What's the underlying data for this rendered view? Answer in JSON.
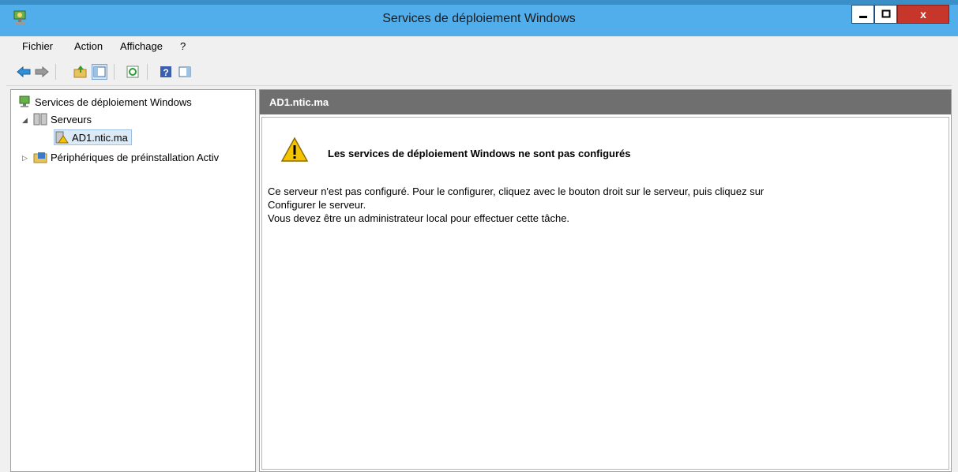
{
  "window": {
    "title": "Services de déploiement Windows",
    "close_label": "x"
  },
  "menu": [
    "Fichier",
    "Action",
    "Affichage",
    "?"
  ],
  "toolbar": {
    "buttons": [
      "back-arrow-icon",
      "forward-arrow-icon",
      "up-folder-icon",
      "show-hide-tree-icon",
      "refresh-icon",
      "help-icon",
      "show-hide-action-pane-icon"
    ]
  },
  "tree": {
    "root": "Services de déploiement Windows",
    "servers": "Serveurs",
    "server_node": "AD1.ntic.ma",
    "devices": "Périphériques de préinstallation Activ"
  },
  "detail": {
    "header": "AD1.ntic.ma",
    "warning_title": "Les services de déploiement Windows ne sont pas configurés",
    "message_line1": "Ce serveur n'est pas configuré. Pour le configurer, cliquez avec le bouton droit sur le serveur, puis cliquez sur",
    "message_line2": "Configurer le serveur.",
    "message_line3": "Vous devez être un administrateur local pour effectuer cette tâche."
  },
  "colors": {
    "titlebar": "#52aeea",
    "close": "#c7362b",
    "header": "#6f6f6f"
  }
}
